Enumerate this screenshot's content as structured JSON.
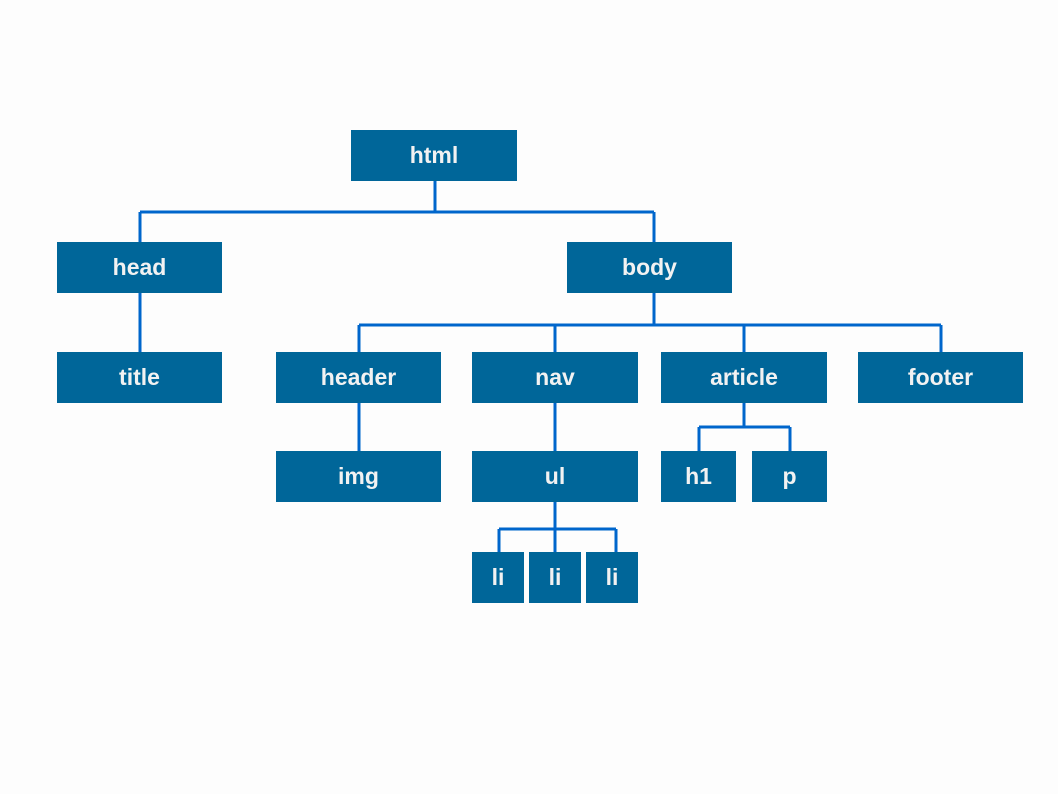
{
  "colors": {
    "node_fill": "#006699",
    "node_text": "#f2f2f2",
    "connector": "#0066cc",
    "background": "#fdfdfd"
  },
  "nodes": {
    "html": "html",
    "head": "head",
    "body": "body",
    "title": "title",
    "header": "header",
    "nav": "nav",
    "article": "article",
    "footer": "footer",
    "img": "img",
    "ul": "ul",
    "h1": "h1",
    "p": "p",
    "li1": "li",
    "li2": "li",
    "li3": "li"
  },
  "edges": [
    [
      "html",
      "head"
    ],
    [
      "html",
      "body"
    ],
    [
      "head",
      "title"
    ],
    [
      "body",
      "header"
    ],
    [
      "body",
      "nav"
    ],
    [
      "body",
      "article"
    ],
    [
      "body",
      "footer"
    ],
    [
      "header",
      "img"
    ],
    [
      "nav",
      "ul"
    ],
    [
      "article",
      "h1"
    ],
    [
      "article",
      "p"
    ],
    [
      "ul",
      "li1"
    ],
    [
      "ul",
      "li2"
    ],
    [
      "ul",
      "li3"
    ]
  ]
}
